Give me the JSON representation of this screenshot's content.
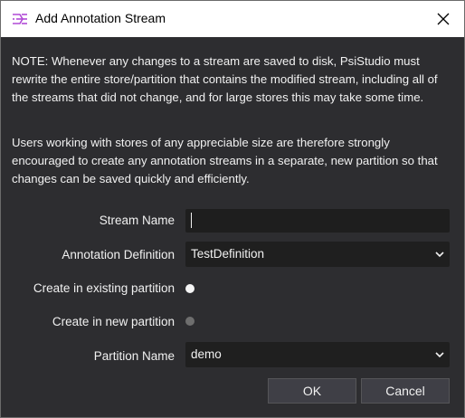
{
  "window": {
    "title": "Add Annotation Stream",
    "icon": "psistudio-stream-icon",
    "close_icon": "close-icon"
  },
  "notes": {
    "warning": "NOTE: Whenever any changes to a stream are saved to disk, PsiStudio must rewrite the entire store/partition that contains the modified stream, including all of the streams that did not change, and for large stores this may take some time.",
    "advice": "Users working with stores of any appreciable size are therefore strongly encouraged to create any annotation streams in a separate, new partition so that changes can be saved quickly and efficiently."
  },
  "form": {
    "stream_name": {
      "label": "Stream Name",
      "value": ""
    },
    "annotation_definition": {
      "label": "Annotation Definition",
      "value": "TestDefinition"
    },
    "create_in_existing": {
      "label": "Create in existing partition",
      "selected": true
    },
    "create_in_new": {
      "label": "Create in new partition",
      "selected": false
    },
    "partition_name": {
      "label": "Partition Name",
      "value": "demo"
    }
  },
  "buttons": {
    "ok": "OK",
    "cancel": "Cancel"
  },
  "colors": {
    "background": "#2d2d30",
    "input_background": "#1e1e1e",
    "text": "#f1f1f1",
    "icon_accent": "#b04ad6"
  }
}
